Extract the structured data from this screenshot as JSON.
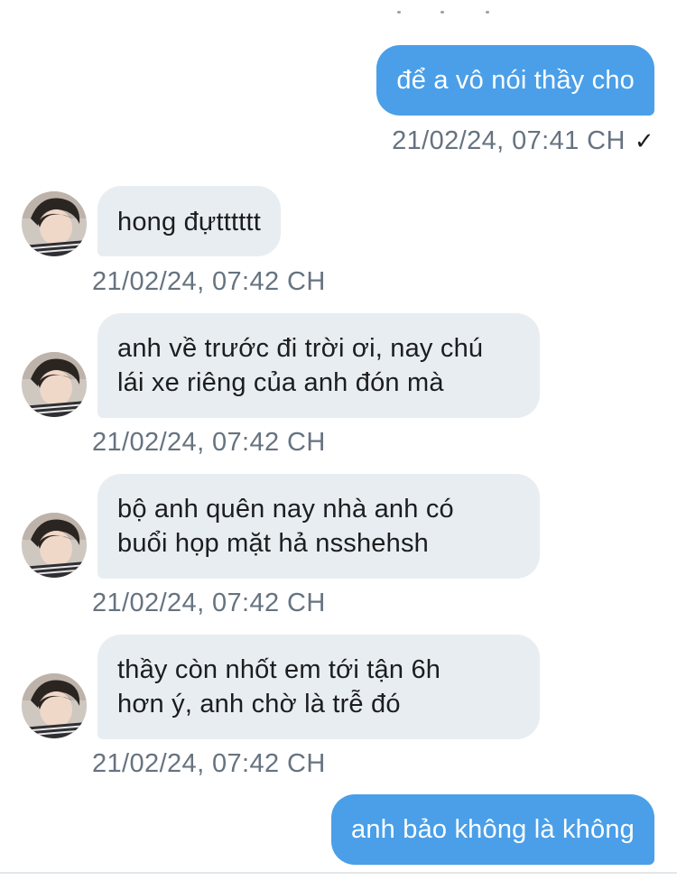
{
  "messages": [
    {
      "id": "m1",
      "direction": "outgoing",
      "lines": [
        "để a vô nói thầy cho"
      ],
      "time": "21/02/24, 07:41 CH",
      "status_icon": "check-icon",
      "status_glyph": "✓"
    },
    {
      "id": "m2",
      "direction": "incoming",
      "lines": [
        "hong đựtttttt"
      ],
      "time": "21/02/24, 07:42 CH"
    },
    {
      "id": "m3",
      "direction": "incoming",
      "lines": [
        "anh về trước đi trời ơi, nay chú",
        "lái xe riêng của anh đón mà"
      ],
      "time": "21/02/24, 07:42 CH"
    },
    {
      "id": "m4",
      "direction": "incoming",
      "lines": [
        "bộ anh quên nay nhà anh có",
        "buổi họp mặt hả nsshehsh"
      ],
      "time": "21/02/24, 07:42 CH"
    },
    {
      "id": "m5",
      "direction": "incoming",
      "lines": [
        "thầy còn nhốt em tới tận 6h",
        "hơn ý, anh chờ là trễ đó"
      ],
      "time": "21/02/24, 07:42 CH"
    },
    {
      "id": "m6",
      "direction": "outgoing",
      "lines": [
        "anh bảo không là không"
      ]
    }
  ],
  "colors": {
    "outgoing_bubble": "#4a9fe8",
    "incoming_bubble": "#e8edf1",
    "timestamp": "#667380"
  }
}
